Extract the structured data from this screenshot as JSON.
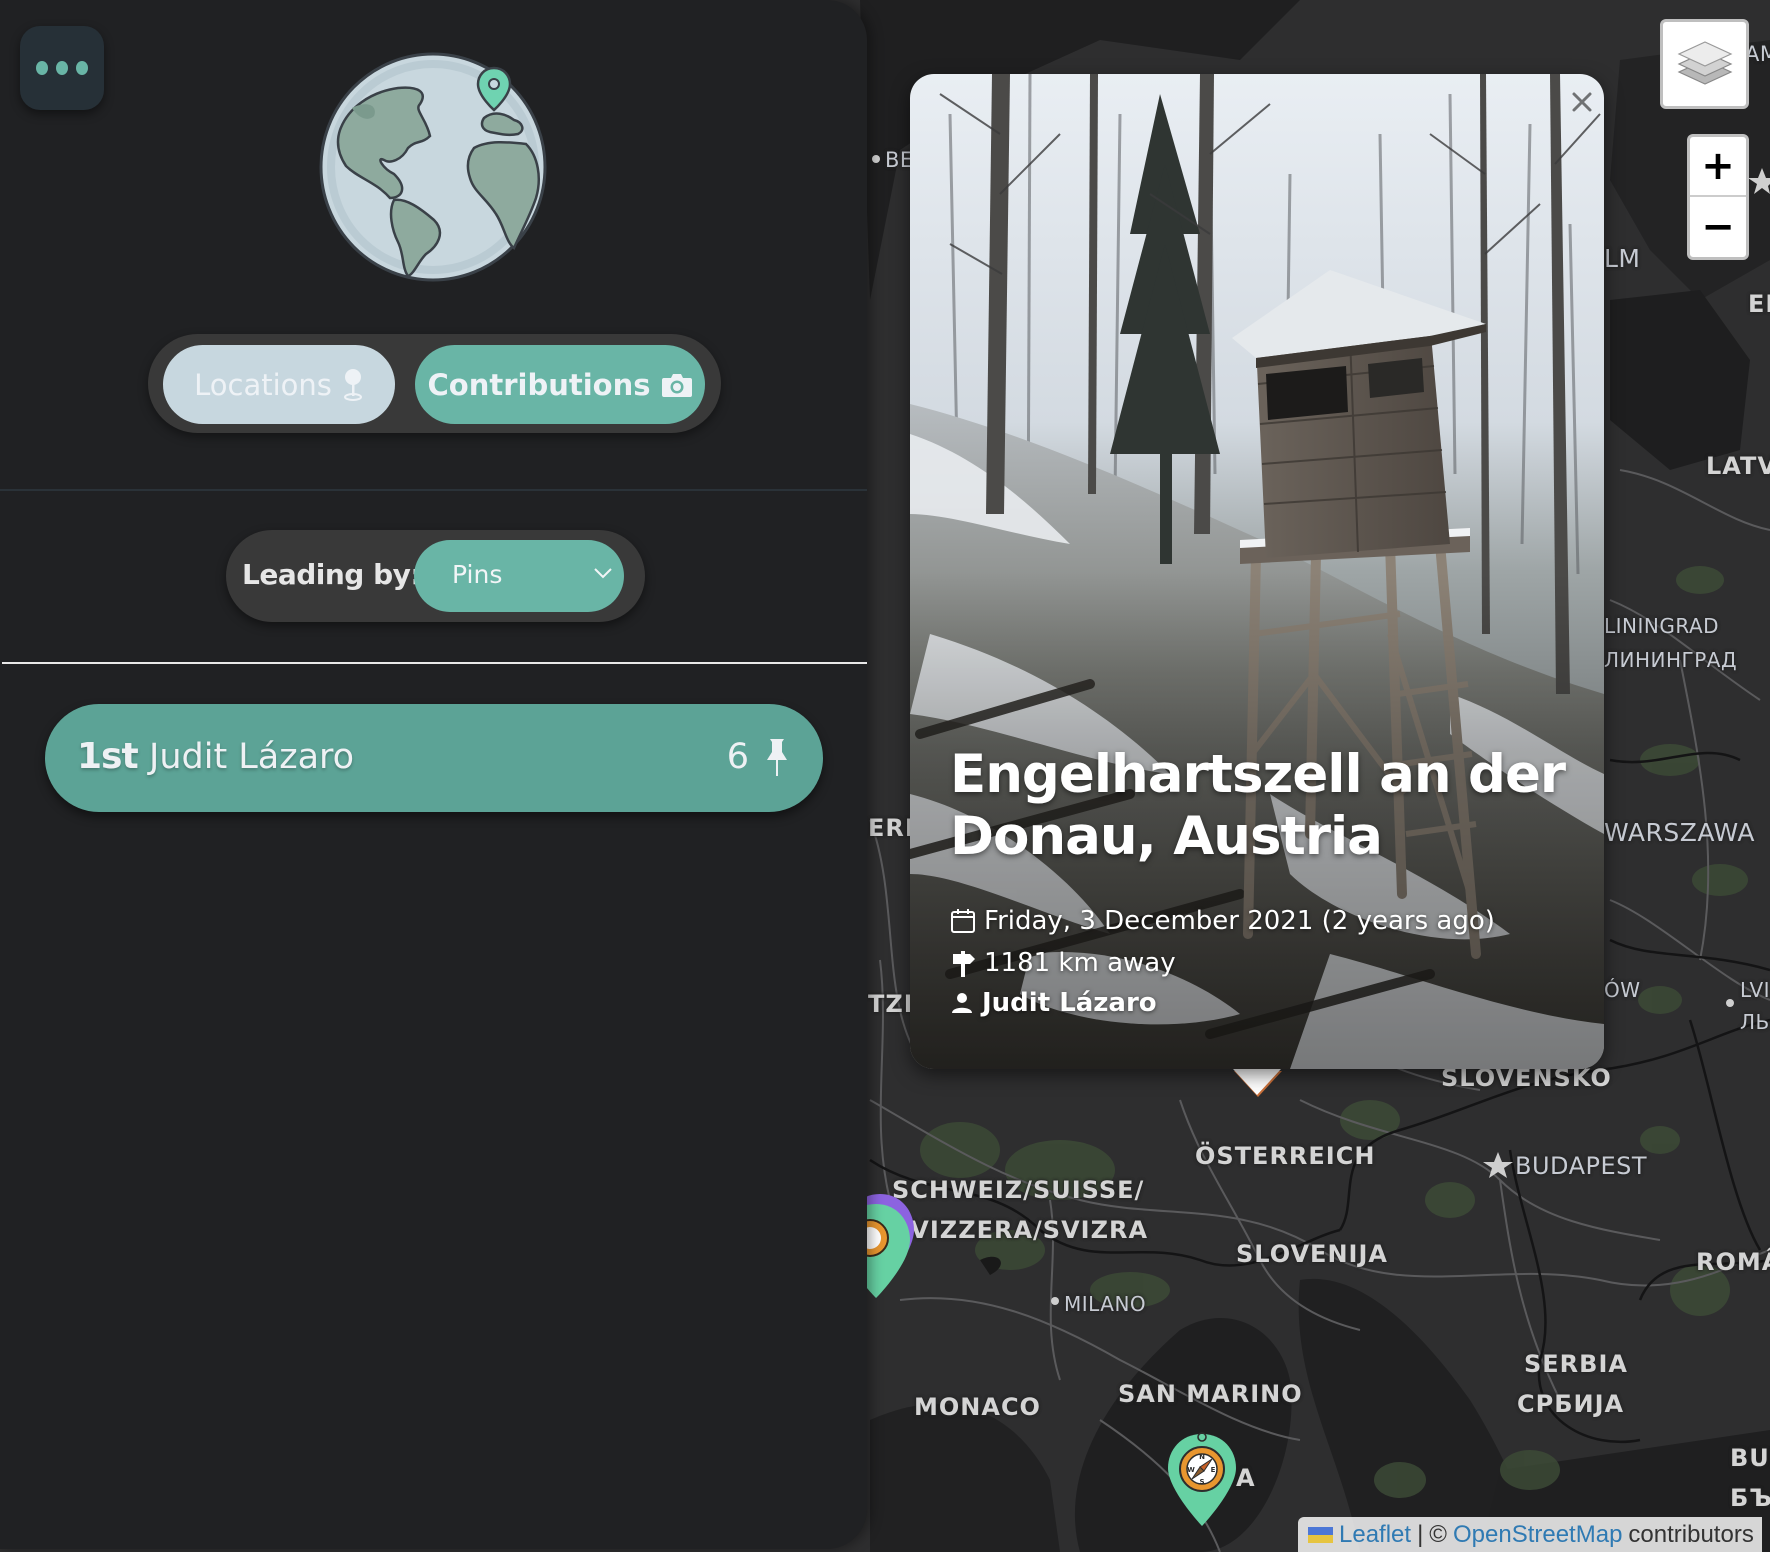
{
  "sidebar": {
    "menu_icon": "ellipsis-icon",
    "logo_icon": "globe-with-pin-icon",
    "view_toggle": {
      "locations_label": "Locations",
      "locations_icon": "map-pin-icon",
      "contributions_label": "Contributions",
      "contributions_icon": "camera-icon",
      "active": "Contributions"
    },
    "leading_by": {
      "label": "Leading by:",
      "selected": "Pins"
    },
    "leaderboard": [
      {
        "rank": "1st",
        "name": "Judit Lázaro",
        "count": "6",
        "icon": "pushpin-icon"
      }
    ]
  },
  "popup": {
    "title": "Engelhartszell an der Donau, Austria",
    "date": "Friday, 3 December 2021 (2 years ago)",
    "distance": "1181 km away",
    "user": "Judit Lázaro",
    "close_label": "×"
  },
  "map": {
    "controls": {
      "layers_icon": "layers-icon",
      "zoom_in": "+",
      "zoom_out": "−"
    },
    "attribution": {
      "leaflet": "Leaflet",
      "separator": "|",
      "copyright": "©",
      "osm": "OpenStreetMap",
      "contributors": "contributors"
    },
    "labels": [
      {
        "text": "BE",
        "kind": "city"
      },
      {
        "text": "AM",
        "kind": "city"
      },
      {
        "text": "LM",
        "kind": "city"
      },
      {
        "text": "EI",
        "kind": "country"
      },
      {
        "text": "LATV",
        "kind": "country"
      },
      {
        "text": "LININGRAD",
        "kind": "city"
      },
      {
        "text": "ЛИНИНГРАД",
        "kind": "city"
      },
      {
        "text": "WARSZAWA",
        "kind": "city"
      },
      {
        "text": "ÓW",
        "kind": "city"
      },
      {
        "text": "LVI",
        "kind": "city"
      },
      {
        "text": "ЛЬ",
        "kind": "city"
      },
      {
        "text": "ERL",
        "kind": "country"
      },
      {
        "text": "TZE",
        "kind": "country"
      },
      {
        "text": "SLOVENSKO",
        "kind": "country"
      },
      {
        "text": "ÖSTERREICH",
        "kind": "country"
      },
      {
        "text": "BUDAPEST",
        "kind": "city"
      },
      {
        "text": "SCHWEIZ/SUISSE/",
        "kind": "country"
      },
      {
        "text": "SVIZZERA/SVIZRA",
        "kind": "country"
      },
      {
        "text": "SLOVENIJA",
        "kind": "country"
      },
      {
        "text": "ROMÂ",
        "kind": "country"
      },
      {
        "text": "MILANO",
        "kind": "city"
      },
      {
        "text": "SERBIA",
        "kind": "country"
      },
      {
        "text": "СРБИЈА",
        "kind": "country"
      },
      {
        "text": "MONACO",
        "kind": "country"
      },
      {
        "text": "SAN MARINO",
        "kind": "country"
      },
      {
        "text": "A",
        "kind": "country"
      },
      {
        "text": "BUI",
        "kind": "country"
      },
      {
        "text": "БЪ",
        "kind": "country"
      }
    ],
    "markers": [
      {
        "name": "compass-marker",
        "color": "#66d1a3"
      },
      {
        "name": "edge-marker-group",
        "color": "#66d1a3"
      }
    ]
  },
  "colors": {
    "accent": "#69b5a6",
    "leader_row": "#5ca396",
    "locations_button": "#c7d7df",
    "sidebar_bg": "#202123",
    "map_bg": "#2e2e2f",
    "marker": "#66d1a3"
  }
}
